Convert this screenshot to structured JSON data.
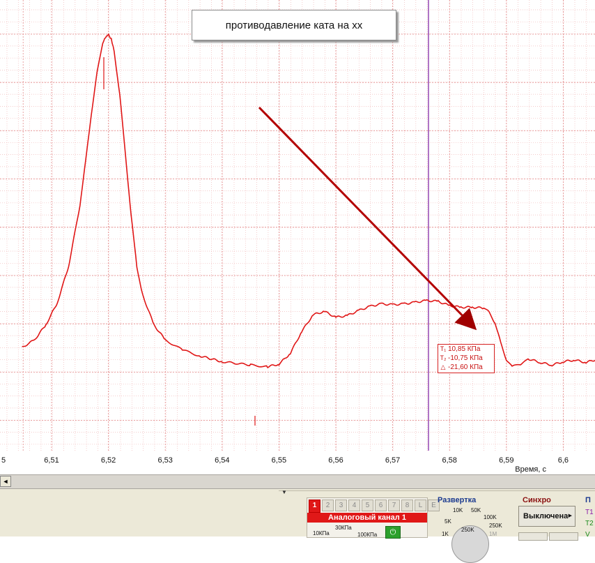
{
  "annotation": {
    "text": "противодавление ката на хх"
  },
  "cursor_readout": {
    "t1_value": "10,85 КПа",
    "t2_value": "-10,75 КПа",
    "delta_value": "-21,60 КПа"
  },
  "chart_data": {
    "type": "line",
    "xlabel": "Время, с",
    "x_tick_labels": [
      "5",
      "6,51",
      "6,52",
      "6,53",
      "6,54",
      "6,55",
      "6,56",
      "6,57",
      "6,58",
      "6,59",
      "6,6"
    ],
    "x_ticks": [
      6.505,
      6.51,
      6.52,
      6.53,
      6.54,
      6.55,
      6.56,
      6.57,
      6.58,
      6.59,
      6.6
    ],
    "xlim": [
      6.5048,
      6.5713
    ],
    "ylim": [
      -14,
      26
    ],
    "grid": true,
    "cursor_x": 6.5763,
    "series": [
      {
        "color": "#e01515",
        "x": [
          6.5048,
          6.507,
          6.509,
          6.511,
          6.513,
          6.515,
          6.516,
          6.517,
          6.518,
          6.519,
          6.5195,
          6.52,
          6.5205,
          6.521,
          6.522,
          6.523,
          6.524,
          6.525,
          6.526,
          6.528,
          6.53,
          6.533,
          6.536,
          6.54,
          6.545,
          6.548,
          6.55,
          6.552,
          6.554,
          6.556,
          6.558,
          6.56,
          6.562,
          6.564,
          6.566,
          6.568,
          6.57,
          6.572,
          6.574,
          6.576,
          6.578,
          6.58,
          6.582,
          6.584,
          6.586,
          6.587,
          6.588,
          6.589,
          6.59,
          6.591,
          6.5925,
          6.594,
          6.596,
          6.598,
          6.6,
          6.602,
          6.604,
          6.606,
          6.6083
        ],
        "values": [
          -11.5,
          -10.6,
          -8.8,
          -6.2,
          -1.8,
          5.5,
          10.8,
          16.4,
          21.3,
          24.9,
          25.5,
          25.8,
          25.4,
          24.0,
          18.6,
          11.6,
          4.2,
          -1.8,
          -5.2,
          -8.8,
          -10.6,
          -11.8,
          -12.5,
          -13.2,
          -13.6,
          -13.8,
          -13.5,
          -12.2,
          -9.6,
          -7.6,
          -7.2,
          -7.9,
          -7.7,
          -7.1,
          -6.6,
          -6.3,
          -6.4,
          -6.3,
          -6.1,
          -5.9,
          -6.0,
          -6.5,
          -6.7,
          -6.7,
          -6.8,
          -7.3,
          -8.6,
          -10.9,
          -13.0,
          -13.8,
          -13.5,
          -12.9,
          -13.3,
          -13.6,
          -13.2,
          -13.0,
          -13.3,
          -12.9,
          -13.1
        ]
      }
    ]
  },
  "scrollbar": {
    "left_arrow": "◄"
  },
  "bottom_panel": {
    "channel": {
      "tabs": [
        "1",
        "2",
        "3",
        "4",
        "5",
        "6",
        "7",
        "8",
        "L",
        "E"
      ],
      "title": "Аналоговый канал 1",
      "scale_labels": [
        "10КПа",
        "30КПа",
        "100КПа"
      ],
      "power_icon": "power-icon"
    },
    "sweep": {
      "title": "Развертка",
      "labels": [
        "10K",
        "50K",
        "100K",
        "5K",
        "250K",
        "250K",
        "1K",
        "1M"
      ]
    },
    "sync": {
      "title": "Синхро",
      "value": "Выключена"
    },
    "side": {
      "title": "П",
      "t1": "T1",
      "t2": "T2",
      "v": "V"
    }
  }
}
